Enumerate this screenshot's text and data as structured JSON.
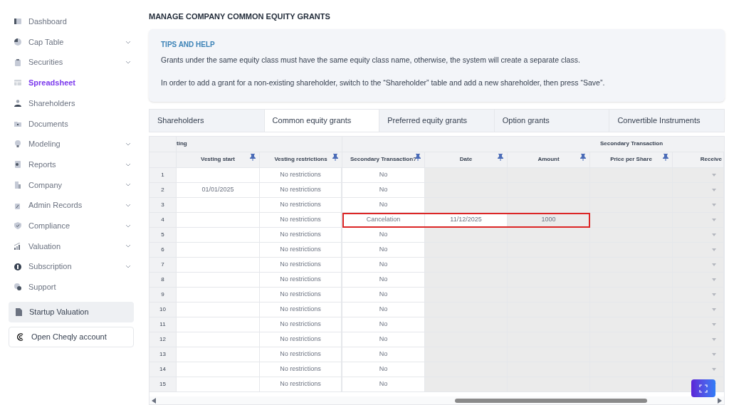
{
  "sidebar": {
    "items": [
      {
        "label": "Dashboard",
        "selected": false,
        "expandable": false
      },
      {
        "label": "Cap Table",
        "selected": false,
        "expandable": true
      },
      {
        "label": "Securities",
        "selected": false,
        "expandable": true
      },
      {
        "label": "Spreadsheet",
        "selected": true,
        "expandable": false
      },
      {
        "label": "Shareholders",
        "selected": false,
        "expandable": false
      },
      {
        "label": "Documents",
        "selected": false,
        "expandable": false
      },
      {
        "label": "Modeling",
        "selected": false,
        "expandable": true
      },
      {
        "label": "Reports",
        "selected": false,
        "expandable": true
      },
      {
        "label": "Company",
        "selected": false,
        "expandable": true
      },
      {
        "label": "Admin Records",
        "selected": false,
        "expandable": true
      },
      {
        "label": "Compliance",
        "selected": false,
        "expandable": true
      },
      {
        "label": "Valuation",
        "selected": false,
        "expandable": true
      },
      {
        "label": "Subscription",
        "selected": false,
        "expandable": true
      },
      {
        "label": "Support",
        "selected": false,
        "expandable": false
      }
    ],
    "startup_button": "Startup Valuation",
    "account_button": "Open Cheqly account"
  },
  "page_title": "MANAGE COMPANY COMMON EQUITY GRANTS",
  "tips": {
    "title": "TIPS AND HELP",
    "paragraphs": [
      "Grants under the same equity class must have the same equity class name, otherwise, the system will create a separate class.",
      "In order to add a grant for a non-existing shareholder, switch to the “Shareholder” table and add a new shareholder, then press “Save”."
    ]
  },
  "tabs": [
    {
      "label": "Shareholders",
      "selected": false
    },
    {
      "label": "Common equity grants",
      "selected": true
    },
    {
      "label": "Preferred equity grants",
      "selected": false
    },
    {
      "label": "Option grants",
      "selected": false
    },
    {
      "label": "Convertible Instruments",
      "selected": false
    }
  ],
  "table": {
    "groups": [
      "ting",
      "Secondary Transaction"
    ],
    "columns": [
      "Vesting start",
      "Vesting restrictions",
      "Secondary Transaction?",
      "Date",
      "Amount",
      "Price per Share",
      "Receive"
    ],
    "rows": [
      {
        "number": "1",
        "vesting_start": "",
        "restrictions": "No restrictions",
        "secondary": "No",
        "date": "",
        "amount": "",
        "highlighted": false
      },
      {
        "number": "2",
        "vesting_start": "01/01/2025",
        "restrictions": "No restrictions",
        "secondary": "No",
        "date": "",
        "amount": "",
        "highlighted": false
      },
      {
        "number": "3",
        "vesting_start": "",
        "restrictions": "No restrictions",
        "secondary": "No",
        "date": "",
        "amount": "",
        "highlighted": false
      },
      {
        "number": "4",
        "vesting_start": "",
        "restrictions": "No restrictions",
        "secondary": "Cancelation",
        "date": "11/12/2025",
        "amount": "1000",
        "highlighted": true
      },
      {
        "number": "5",
        "vesting_start": "",
        "restrictions": "No restrictions",
        "secondary": "No",
        "date": "",
        "amount": "",
        "highlighted": false
      },
      {
        "number": "6",
        "vesting_start": "",
        "restrictions": "No restrictions",
        "secondary": "No",
        "date": "",
        "amount": "",
        "highlighted": false
      },
      {
        "number": "7",
        "vesting_start": "",
        "restrictions": "No restrictions",
        "secondary": "No",
        "date": "",
        "amount": "",
        "highlighted": false
      },
      {
        "number": "8",
        "vesting_start": "",
        "restrictions": "No restrictions",
        "secondary": "No",
        "date": "",
        "amount": "",
        "highlighted": false
      },
      {
        "number": "9",
        "vesting_start": "",
        "restrictions": "No restrictions",
        "secondary": "No",
        "date": "",
        "amount": "",
        "highlighted": false
      },
      {
        "number": "10",
        "vesting_start": "",
        "restrictions": "No restrictions",
        "secondary": "No",
        "date": "",
        "amount": "",
        "highlighted": false
      },
      {
        "number": "11",
        "vesting_start": "",
        "restrictions": "No restrictions",
        "secondary": "No",
        "date": "",
        "amount": "",
        "highlighted": false
      },
      {
        "number": "12",
        "vesting_start": "",
        "restrictions": "No restrictions",
        "secondary": "No",
        "date": "",
        "amount": "",
        "highlighted": false
      },
      {
        "number": "13",
        "vesting_start": "",
        "restrictions": "No restrictions",
        "secondary": "No",
        "date": "",
        "amount": "",
        "highlighted": false
      },
      {
        "number": "14",
        "vesting_start": "",
        "restrictions": "No restrictions",
        "secondary": "No",
        "date": "",
        "amount": "",
        "highlighted": false
      },
      {
        "number": "15",
        "vesting_start": "",
        "restrictions": "No restrictions",
        "secondary": "No",
        "date": "",
        "amount": "",
        "highlighted": false
      }
    ]
  }
}
